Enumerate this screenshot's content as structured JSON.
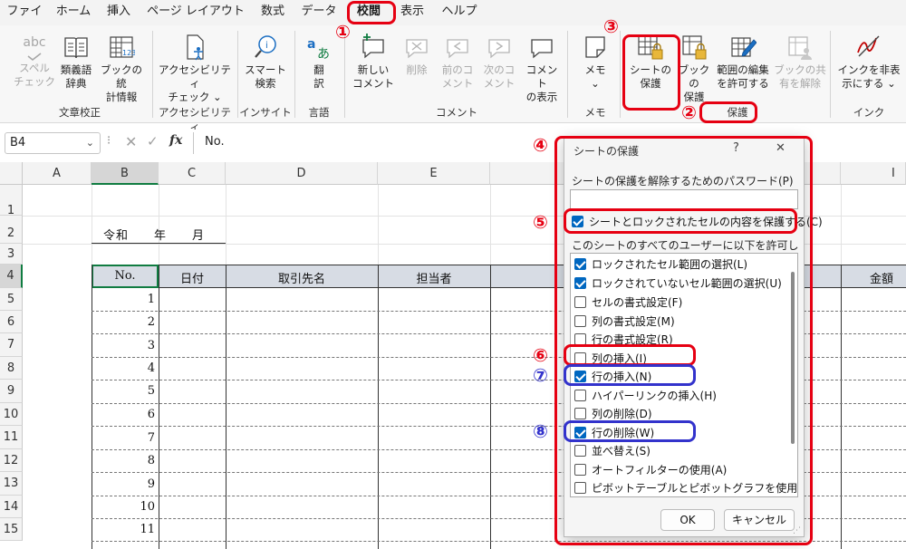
{
  "menu": [
    "ファイル",
    "ホーム",
    "挿入",
    "ページ レイアウト",
    "数式",
    "データ",
    "校閲",
    "表示",
    "ヘルプ"
  ],
  "menu_active_index": 6,
  "ribbon": {
    "spell_line1": "スペル",
    "spell_line2": "チェック",
    "spell_icon_text": "abc",
    "thesaurus_line1": "類義語",
    "thesaurus_line2": "辞典",
    "stats_line1": "ブックの統",
    "stats_line2": "計情報",
    "stats_icon_text": "123",
    "access_line1": "アクセシビリティ",
    "access_line2": "チェック ⌄",
    "smart_line1": "スマート",
    "smart_line2": "検索",
    "translate_line1": "翻",
    "translate_line2": "訳",
    "translate_icon_text": "あ",
    "newcomment_line1": "新しい",
    "newcomment_line2": "コメント",
    "delete_label": "削除",
    "prev_line1": "前のコ",
    "prev_line2": "メント",
    "next_line1": "次のコ",
    "next_line2": "メント",
    "show_line1": "コメント",
    "show_line2": "の表示",
    "memo_label": "メモ",
    "memo_sub": "⌄",
    "protect_sheet_line1": "シートの",
    "protect_sheet_line2": "保護",
    "protect_book_line1": "ブックの",
    "protect_book_line2": "保護",
    "allow_edit_line1": "範囲の編集",
    "allow_edit_line2": "を許可する",
    "share_line1": "ブックの共",
    "share_line2": "有を解除",
    "ink_line1": "インクを非表",
    "ink_line2": "示にする ⌄",
    "groups": {
      "proofing": "文章校正",
      "accessibility": "アクセシビリティ",
      "insights": "インサイト",
      "language": "言語",
      "comments": "コメント",
      "memo": "メモ",
      "protect": "保護",
      "ink": "インク"
    }
  },
  "formula_bar": {
    "name_box": "B4",
    "fx": "fx",
    "content": "No."
  },
  "sheet": {
    "columns": [
      "A",
      "B",
      "C",
      "D",
      "E",
      "I"
    ],
    "rows": [
      "1",
      "2",
      "3",
      "4",
      "5",
      "6",
      "7",
      "8",
      "9",
      "10",
      "11",
      "12",
      "13",
      "14",
      "15"
    ],
    "reiwa_line": "令和　　年　　月",
    "header_no": "No.",
    "header_date": "日付",
    "header_client": "取引先名",
    "header_person": "担当者",
    "header_amount": "金額",
    "numbers": [
      "1",
      "2",
      "3",
      "4",
      "5",
      "6",
      "7",
      "8",
      "9",
      "10",
      "11"
    ]
  },
  "dialog": {
    "title": "シートの保護",
    "help": "?",
    "close": "✕",
    "password_label": "シートの保護を解除するためのパスワード(P)",
    "protect_label": "シートとロックされたセルの内容を保護する(C)",
    "allow_label": "このシートのすべてのユーザーに以下を許可します。",
    "options": [
      {
        "label": "ロックされたセル範囲の選択(L)",
        "checked": true
      },
      {
        "label": "ロックされていないセル範囲の選択(U)",
        "checked": true
      },
      {
        "label": "セルの書式設定(F)",
        "checked": false
      },
      {
        "label": "列の書式設定(M)",
        "checked": false
      },
      {
        "label": "行の書式設定(R)",
        "checked": false
      },
      {
        "label": "列の挿入(I)",
        "checked": false
      },
      {
        "label": "行の挿入(N)",
        "checked": true
      },
      {
        "label": "ハイパーリンクの挿入(H)",
        "checked": false
      },
      {
        "label": "列の削除(D)",
        "checked": false
      },
      {
        "label": "行の削除(W)",
        "checked": true
      },
      {
        "label": "並べ替え(S)",
        "checked": false
      },
      {
        "label": "オートフィルターの使用(A)",
        "checked": false
      },
      {
        "label": "ピボットテーブルとピボットグラフを使用する",
        "checked": false
      }
    ],
    "ok": "OK",
    "cancel": "キャンセル"
  },
  "annotations": {
    "n1": "①",
    "n2": "②",
    "n3": "③",
    "n4": "④",
    "n5": "⑤",
    "n6": "⑥",
    "n7": "⑦",
    "n8": "⑧"
  },
  "colors": {
    "annotation_red": "#e60012",
    "annotation_blue": "#3333cc",
    "checkbox_blue": "#0067c0",
    "excel_green": "#107c41"
  }
}
